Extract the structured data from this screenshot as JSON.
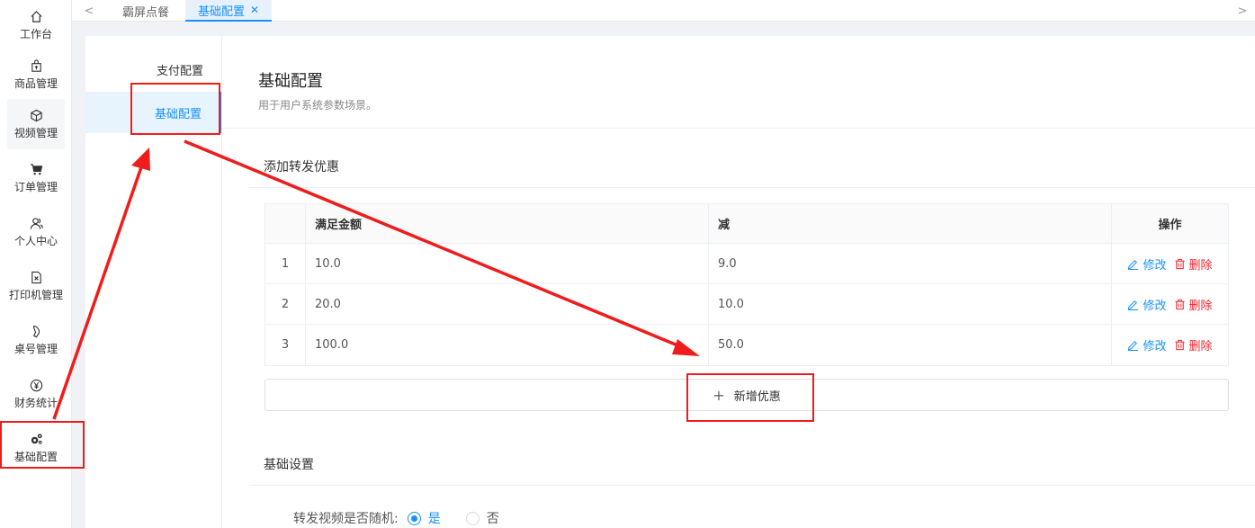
{
  "rail": {
    "items": [
      {
        "label": "工作台",
        "icon": "home-icon"
      },
      {
        "label": "商品管理",
        "icon": "shopping-bag-icon"
      },
      {
        "label": "视频管理",
        "icon": "cube-icon"
      },
      {
        "label": "订单管理",
        "icon": "cart-icon"
      },
      {
        "label": "个人中心",
        "icon": "user-icon"
      },
      {
        "label": "打印机管理",
        "icon": "file-x-icon"
      },
      {
        "label": "桌号管理",
        "icon": "tag-icon"
      },
      {
        "label": "财务统计",
        "icon": "yen-icon"
      },
      {
        "label": "基础配置",
        "icon": "gears-icon"
      }
    ]
  },
  "tabs": {
    "prev": "<",
    "next": ">",
    "items": [
      {
        "label": "霸屏点餐"
      },
      {
        "label": "基础配置",
        "close": "✕"
      }
    ]
  },
  "subnav": {
    "items": [
      {
        "label": "支付配置"
      },
      {
        "label": "基础配置"
      }
    ]
  },
  "header": {
    "title": "基础配置",
    "subtitle": "用于用户系统参数场景。"
  },
  "discount": {
    "section_title": "添加转发优惠",
    "columns": [
      "",
      "满足金额",
      "减",
      "操作"
    ],
    "rows": [
      {
        "index": "1",
        "amount": "10.0",
        "minus": "9.0"
      },
      {
        "index": "2",
        "amount": "20.0",
        "minus": "10.0"
      },
      {
        "index": "3",
        "amount": "100.0",
        "minus": "50.0"
      }
    ],
    "edit_label": "修改",
    "delete_label": "删除",
    "add_plus": "+",
    "add_label": "新增优惠"
  },
  "basic": {
    "section_title": "基础设置",
    "random_label": "转发视频是否随机:",
    "options": [
      {
        "label": "是",
        "checked": true
      },
      {
        "label": "否",
        "checked": false
      }
    ]
  },
  "colors": {
    "primary": "#1890ff",
    "danger": "#f5222d",
    "annotation": "#f01c1c"
  }
}
